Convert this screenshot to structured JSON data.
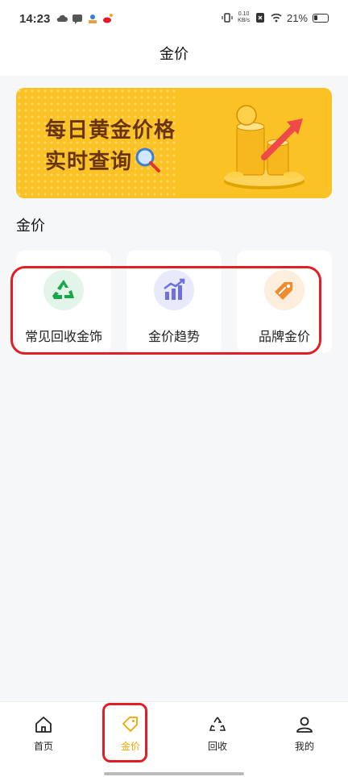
{
  "status_bar": {
    "time": "14:23",
    "net_speed_value": "0.10",
    "net_speed_unit": "KB/s",
    "battery": "21%",
    "icons": [
      "cloud-icon",
      "message-icon",
      "app-icon",
      "weibo-icon",
      "vibrate-icon",
      "sim-x-icon",
      "wifi-icon",
      "battery-icon"
    ]
  },
  "header": {
    "title": "金价"
  },
  "banner": {
    "line1": "每日黄金价格",
    "line2": "实时查询",
    "colors": {
      "background": "#fbc225",
      "text": "#6b3410"
    }
  },
  "section": {
    "title": "金价"
  },
  "cards": [
    {
      "label": "常见回收金饰",
      "icon": "recycle-icon",
      "icon_color": "#18a64a",
      "bg": "#e3f5e8"
    },
    {
      "label": "金价趋势",
      "icon": "trend-chart-icon",
      "icon_color": "#6e6fe0",
      "bg": "#e8e9fb"
    },
    {
      "label": "品牌金价",
      "icon": "price-tag-icon",
      "icon_color": "#f08c2c",
      "bg": "#fdeede"
    }
  ],
  "bottom_nav": {
    "items": [
      {
        "label": "首页",
        "icon": "home-icon",
        "active": false
      },
      {
        "label": "金价",
        "icon": "tag-icon",
        "active": true
      },
      {
        "label": "回收",
        "icon": "recycle-icon",
        "active": false
      },
      {
        "label": "我的",
        "icon": "user-icon",
        "active": false
      }
    ],
    "active_color": "#f0a500"
  },
  "annotation_color": "#e01e26"
}
